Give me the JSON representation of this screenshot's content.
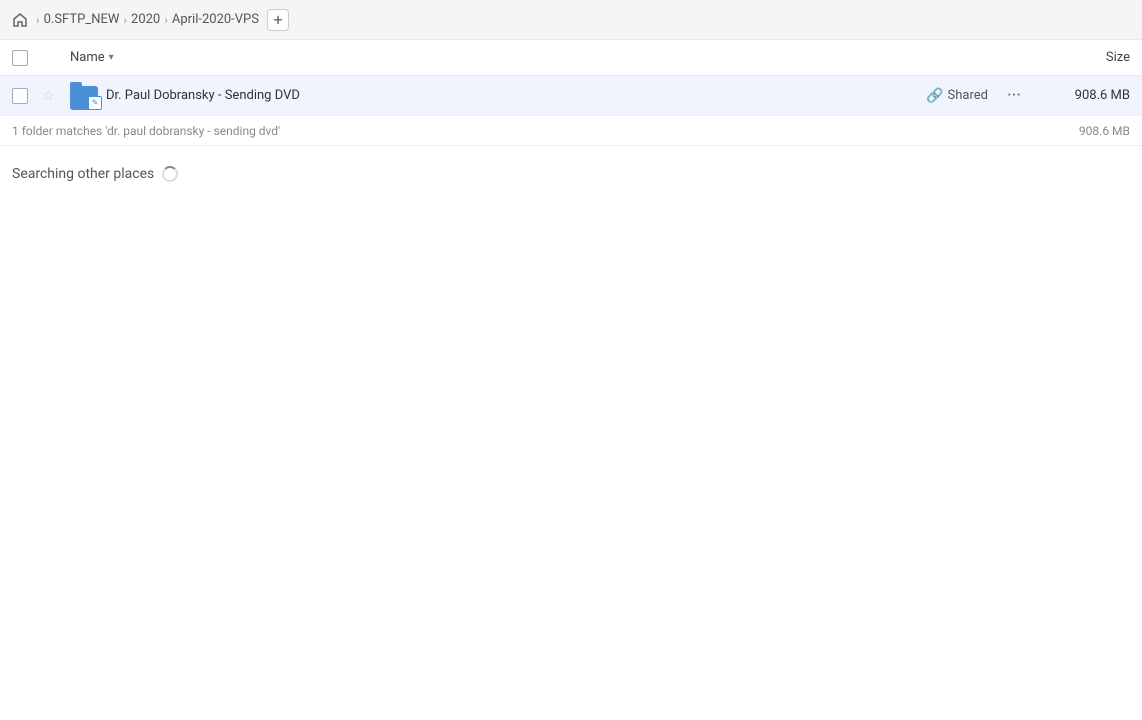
{
  "breadcrumb": {
    "home_icon": "🏠",
    "items": [
      {
        "label": "0.SFTP_NEW"
      },
      {
        "label": "2020"
      },
      {
        "label": "April-2020-VPS"
      }
    ],
    "add_label": "+"
  },
  "column_header": {
    "name_label": "Name",
    "name_chevron": "▾",
    "size_label": "Size"
  },
  "file_row": {
    "name": "Dr. Paul Dobransky - Sending DVD",
    "shared_label": "Shared",
    "size": "908.6 MB",
    "more_icon": "•••"
  },
  "status": {
    "match_text": "1 folder matches 'dr. paul dobransky - sending dvd'",
    "match_size": "908.6 MB"
  },
  "searching": {
    "label": "Searching other places"
  }
}
